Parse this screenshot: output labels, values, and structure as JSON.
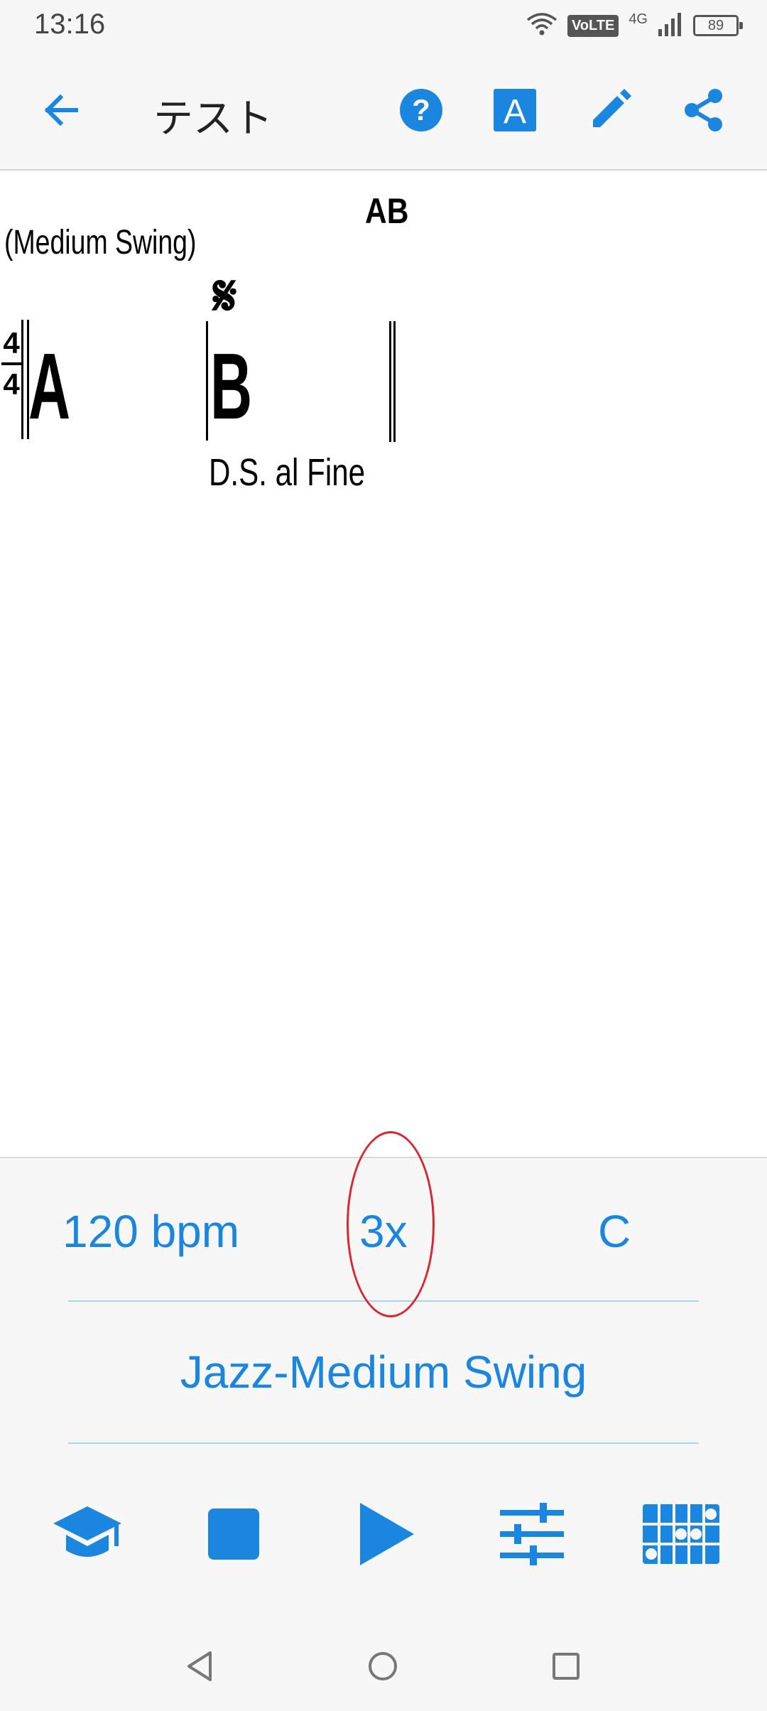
{
  "status_bar": {
    "time": "13:16",
    "volte": "VoLTE",
    "network": "4G",
    "battery": "89",
    "icons": [
      "wifi-icon",
      "volte-icon",
      "signal-icon",
      "battery-icon"
    ]
  },
  "app_bar": {
    "title": "テスト",
    "icons": [
      "back-arrow-icon",
      "help-icon",
      "font-a-icon",
      "edit-pencil-icon",
      "share-icon"
    ],
    "font_button_letter": "A"
  },
  "score": {
    "title": "AB",
    "style": "(Medium Swing)",
    "time_signature": {
      "top": "4",
      "bottom": "4"
    },
    "sections": [
      {
        "label": "A"
      },
      {
        "label": "B",
        "marker": "𝄋",
        "direction": "D.S. al Fine"
      }
    ]
  },
  "controls": {
    "tempo": "120 bpm",
    "repeat": "3x",
    "key": "C",
    "style": "Jazz-Medium Swing"
  },
  "toolbar": {
    "icons": [
      "learn-cap-icon",
      "stop-icon",
      "play-icon",
      "mixer-sliders-icon",
      "chord-grid-icon"
    ]
  },
  "nav_bar": {
    "icons": [
      "nav-back-icon",
      "nav-home-icon",
      "nav-recents-icon"
    ]
  },
  "colors": {
    "accent": "#1a86df",
    "highlight": "#d9262f",
    "divider": "#a9d2f3",
    "background": "#f7f7f7"
  }
}
